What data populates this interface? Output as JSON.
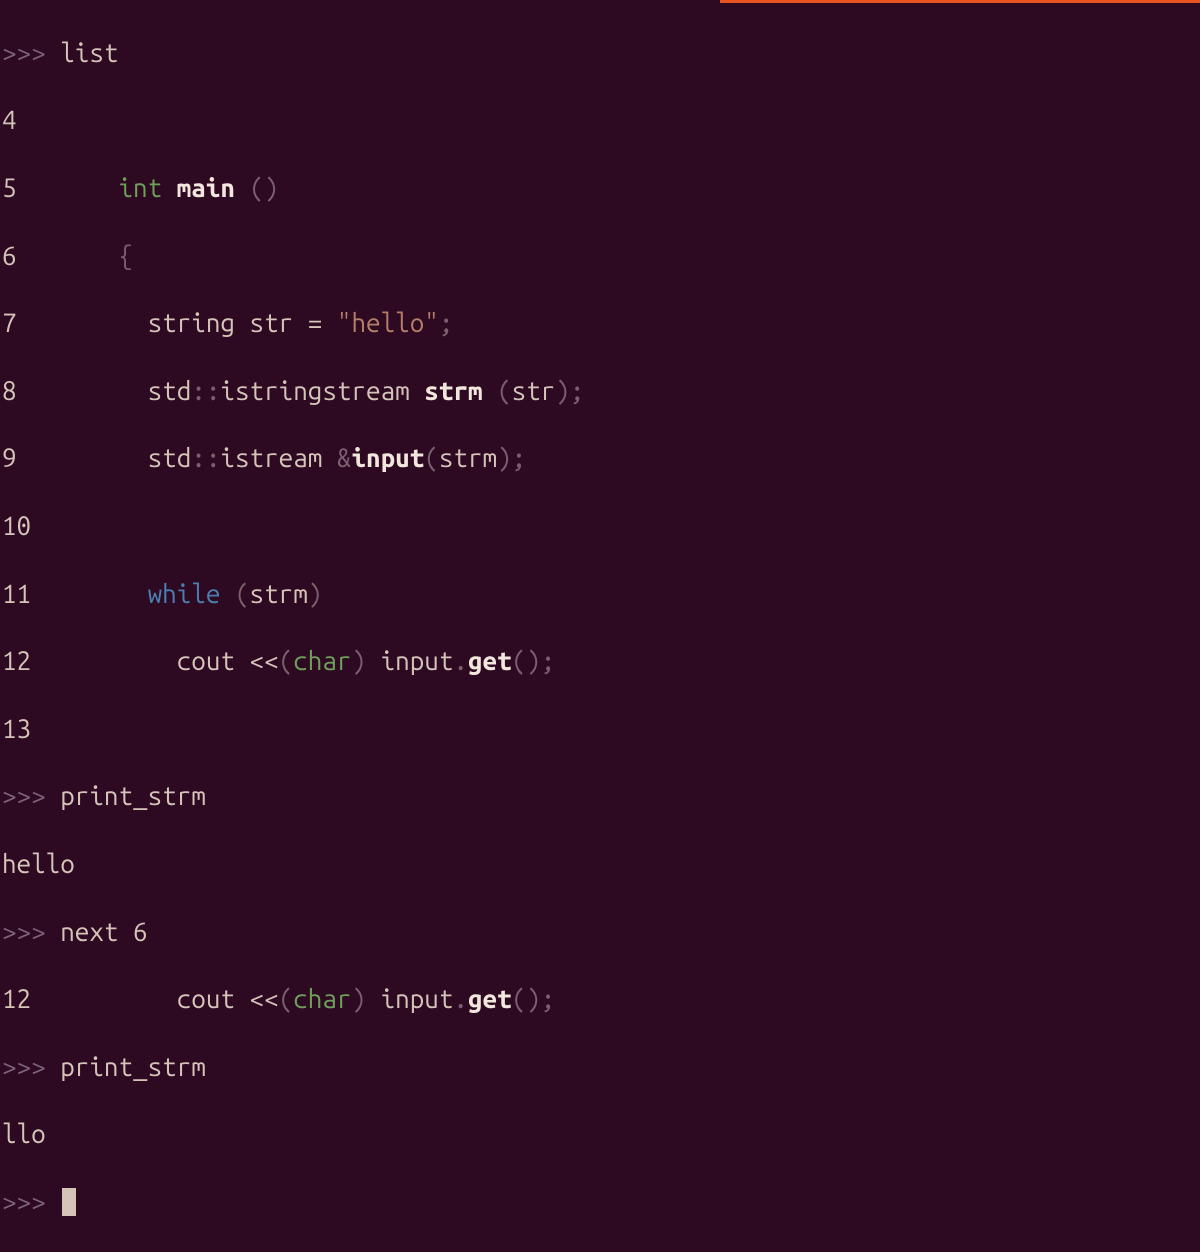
{
  "prompt": ">>>",
  "cmd_list": "list",
  "cmd_print_strm_1": "print_strm",
  "cmd_next": "next 6",
  "cmd_print_strm_2": "print_strm",
  "output_hello": "hello",
  "output_llo": "llo",
  "ln4": "4",
  "ln5": "5",
  "ln6": "6",
  "ln7": "7",
  "ln8": "8",
  "ln9": "9",
  "ln10": "10",
  "ln11": "11",
  "ln12": "12",
  "ln13": "13",
  "ln12b": "12",
  "tok_int": "int",
  "tok_main": "main",
  "tok_lparen": "(",
  "tok_rparen": ")",
  "tok_lbrace": "{",
  "tok_string_kw": "string",
  "tok_str": "str",
  "tok_eq": "=",
  "tok_hello_str": "\"hello\"",
  "tok_semi": ";",
  "tok_std": "std",
  "tok_scope": "::",
  "tok_istringstream": "istringstream",
  "tok_strm": "strm",
  "tok_istream": "istream",
  "tok_amp": "&",
  "tok_input": "input",
  "tok_while": "while",
  "tok_cout": "cout",
  "tok_ins": "<<",
  "tok_char": "char",
  "tok_dot": ".",
  "tok_get": "get",
  "tok_empty_parens": "()"
}
